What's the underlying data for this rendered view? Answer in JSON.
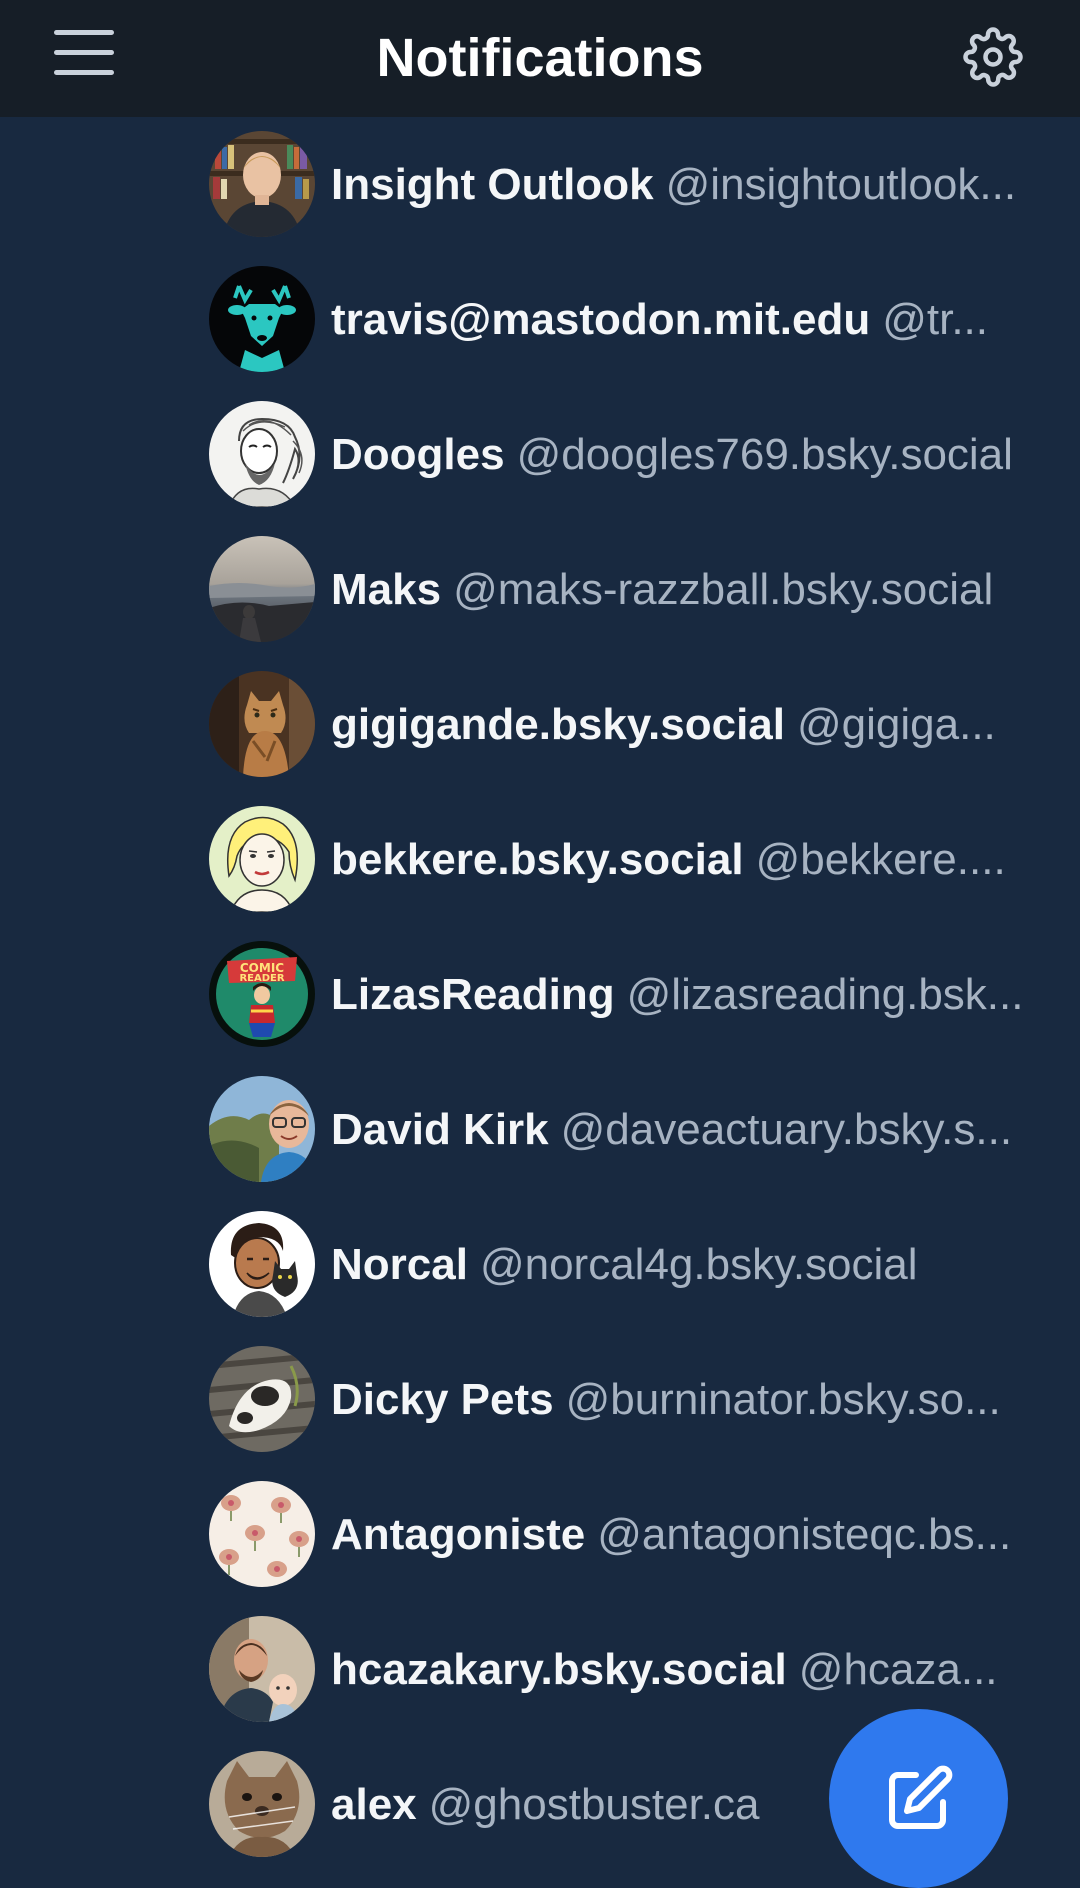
{
  "header": {
    "title": "Notifications",
    "menu_icon": "hamburger-menu-icon",
    "settings_icon": "gear-icon"
  },
  "notifications": [
    {
      "name": "Insight Outlook",
      "handle": "@insightoutlook..."
    },
    {
      "name": "travis@mastodon.mit.edu",
      "handle": "@tr..."
    },
    {
      "name": "Doogles",
      "handle": "@doogles769.bsky.social"
    },
    {
      "name": "Maks",
      "handle": "@maks-razzball.bsky.social"
    },
    {
      "name": "gigigande.bsky.social",
      "handle": "@gigiga..."
    },
    {
      "name": "bekkere.bsky.social",
      "handle": "@bekkere...."
    },
    {
      "name": "LizasReading",
      "handle": "@lizasreading.bsk..."
    },
    {
      "name": "David Kirk",
      "handle": "@daveactuary.bsky.s..."
    },
    {
      "name": "Norcal",
      "handle": "@norcal4g.bsky.social"
    },
    {
      "name": "Dicky Pets",
      "handle": "@burninator.bsky.so..."
    },
    {
      "name": "Antagoniste",
      "handle": "@antagonisteqc.bs..."
    },
    {
      "name": "hcazakary.bsky.social",
      "handle": "@hcaza..."
    },
    {
      "name": "alex",
      "handle": "@ghostbuster.ca"
    }
  ],
  "compose_button": {
    "icon": "compose-icon"
  },
  "colors": {
    "background": "#182940",
    "header": "#161e27",
    "accent": "#2f79ee"
  }
}
